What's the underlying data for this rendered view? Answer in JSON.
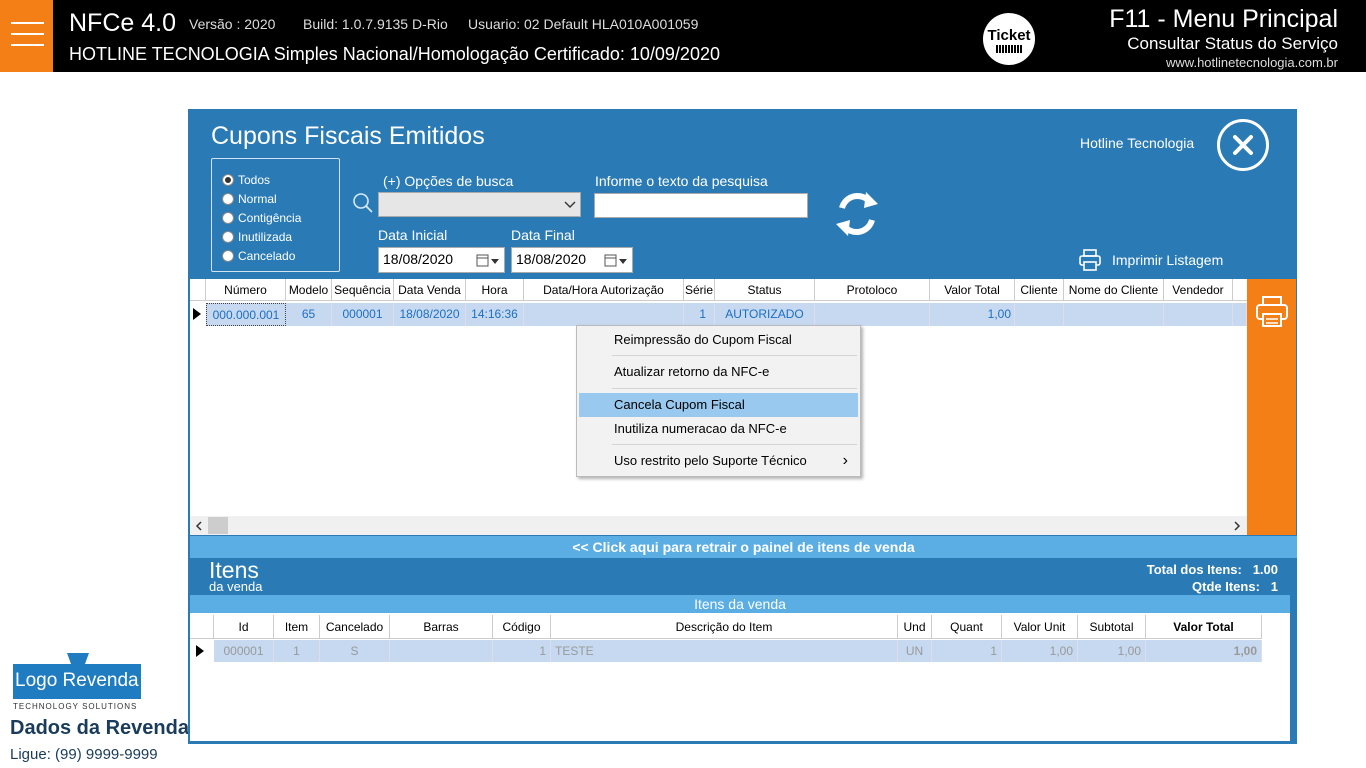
{
  "topbar": {
    "app_name": "NFCe 4.0",
    "version": "Versão : 2020",
    "build": "Build: 1.0.7.9135 D-Rio",
    "user": "Usuario: 02 Default  HLA010A001059",
    "company_line": "HOTLINE TECNOLOGIA   Simples Nacional/Homologação  Certificado: 10/09/2020",
    "logo_text": "Ticket",
    "menu_title": "F11 - Menu Principal",
    "service_status": "Consultar Status do Serviço",
    "website": "www.hotlinetecnologia.com.br"
  },
  "dialog": {
    "title": "Cupons Fiscais Emitidos",
    "company": "Hotline Tecnologia",
    "filters": [
      "Todos",
      "Normal",
      "Contigência",
      "Inutilizada",
      "Cancelado"
    ],
    "search_options_label": "(+) Opções de busca",
    "search_text_label": "Informe o texto da pesquisa",
    "date_start_label": "Data Inicial",
    "date_start": "18/08/2020",
    "date_end_label": "Data Final",
    "date_end": "18/08/2020",
    "print_list": "Imprimir Listagem"
  },
  "grid": {
    "headers": [
      "Número",
      "Modelo",
      "Sequência",
      "Data Venda",
      "Hora",
      "Data/Hora Autorização",
      "Série",
      "Status",
      "Protoloco",
      "Valor Total",
      "Cliente",
      "Nome do Cliente",
      "Vendedor"
    ],
    "row": [
      "000.000.001",
      "65",
      "000001",
      "18/08/2020",
      "14:16:36",
      "",
      "1",
      "AUTORIZADO",
      "",
      "1,00",
      "",
      "",
      ""
    ]
  },
  "context_menu": {
    "items": [
      "Reimpressão do Cupom Fiscal",
      "Atualizar retorno da NFC-e",
      "Cancela Cupom Fiscal",
      "Inutiliza numeracao da NFC-e",
      "Uso restrito pelo Suporte Técnico"
    ],
    "submenu_arrow": "›"
  },
  "items_panel": {
    "retract": "<< Click aqui para retrair o painel de itens de venda",
    "title": "Itens",
    "subtitle": "da venda",
    "total_label": "Total dos Itens:",
    "total_value": "1.00",
    "qty_label": "Qtde Itens:",
    "qty_value": "1",
    "bar_title": "Itens da venda",
    "headers": [
      "Id",
      "Item",
      "Cancelado",
      "Barras",
      "Código",
      "Descrição do Item",
      "Und",
      "Quant",
      "Valor Unit",
      "Subtotal",
      "Valor Total"
    ],
    "row": [
      "000001",
      "1",
      "S",
      "",
      "1",
      "TESTE",
      "UN",
      "1",
      "1,00",
      "1,00",
      "1,00"
    ]
  },
  "reseller": {
    "logo": "Logo Revenda",
    "tagline": "TECHNOLOGY SOLUTIONS",
    "name": "Dados da Revenda",
    "phone": "Ligue: (99) 9999-9999"
  },
  "colors": {
    "accent": "#f57f17",
    "panel": "#2a7bb5",
    "light_blue": "#5aaee4"
  }
}
